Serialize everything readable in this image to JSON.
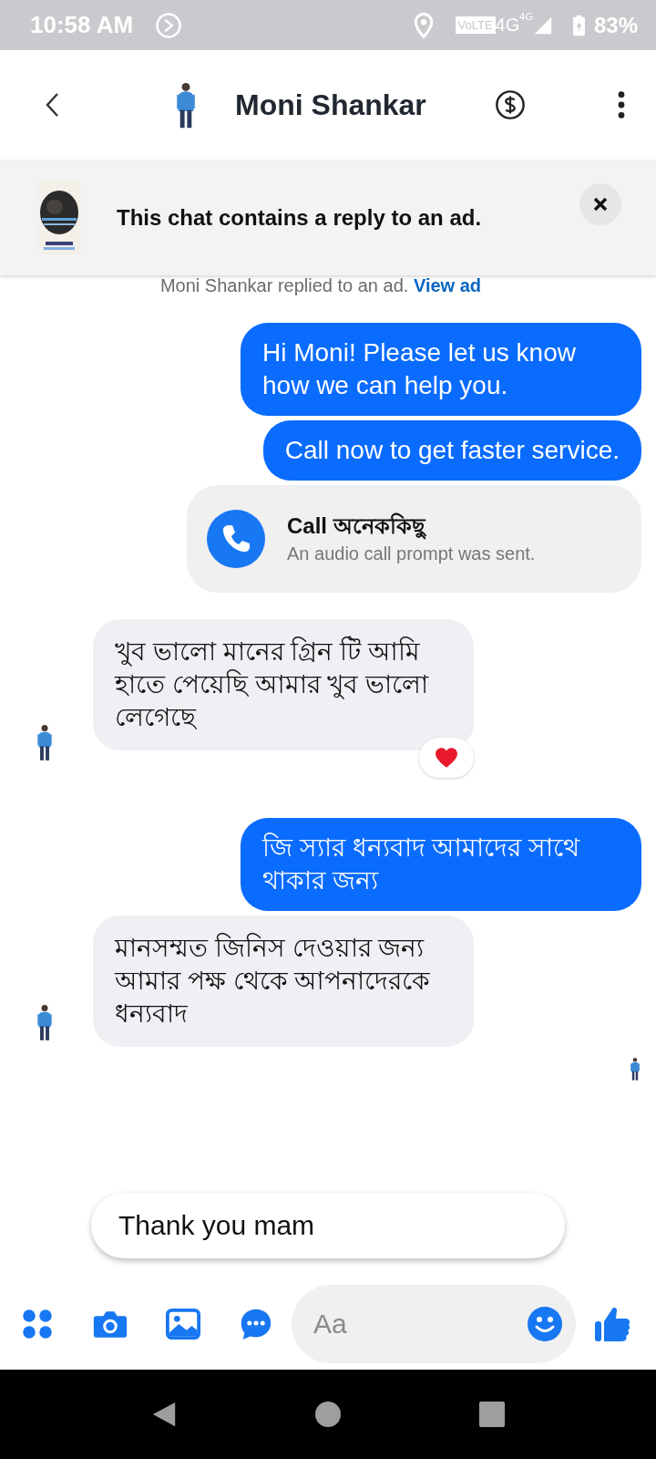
{
  "status_bar": {
    "time": "10:58 AM",
    "volte": "VoLTE",
    "network": "4G",
    "network_small": "4G",
    "battery": "83%"
  },
  "header": {
    "title": "Moni Shankar"
  },
  "ad_banner": {
    "text": "This chat contains a reply to an ad.",
    "kind": "picture"
  },
  "ad_note": {
    "text": "Moni Shankar replied to an ad.",
    "link": "View ad"
  },
  "messages": [
    {
      "kind": "outgoing",
      "text": "Hi Moni! Please let us know how we can help you."
    },
    {
      "kind": "outgoing",
      "text": "Call now to get faster service."
    },
    {
      "kind": "call_card",
      "title": "Call অনেককিছু",
      "subtitle": "An audio call prompt was sent."
    },
    {
      "kind": "incoming",
      "text": "খুব ভালো মানের গ্রিন টি আমি হাতে পেয়েছি আমার খুব ভালো লেগেছে",
      "reacted": true
    },
    {
      "kind": "outgoing",
      "text": "জি স্যার ধন্যবাদ আমাদের সাথে থাকার জন্য"
    },
    {
      "kind": "incoming",
      "text": "মানসম্মত জিনিস দেওয়ার জন্য আমার পক্ষ থেকে আপনাদেরকে ধন্যবাদ",
      "reacted": false
    }
  ],
  "seen": true,
  "suggested_reply": "Thank you mam",
  "composer": {
    "placeholder": "Aa"
  }
}
